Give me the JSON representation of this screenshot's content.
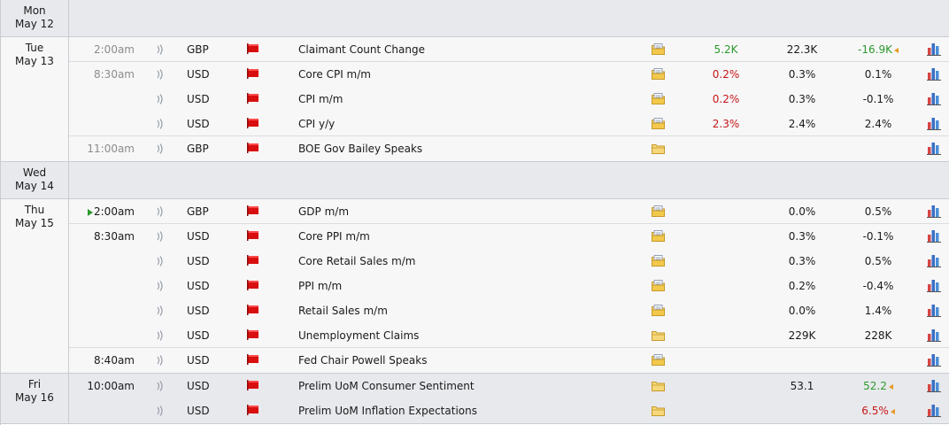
{
  "calendar": {
    "days": [
      {
        "day": "Mon",
        "date": "May 12",
        "events": []
      },
      {
        "day": "Tue",
        "date": "May 13",
        "events": [
          {
            "time": "2:00am",
            "time_bold": false,
            "upnext": false,
            "currency": "GBP",
            "title": "Claimant Count Change",
            "folder": "detail",
            "actual": "5.2K",
            "actual_color": "green",
            "forecast": "22.3K",
            "previous": "-16.9K",
            "previous_color": "green",
            "previous_revised": true,
            "sep": true
          },
          {
            "time": "8:30am",
            "time_bold": false,
            "upnext": false,
            "currency": "USD",
            "title": "Core CPI m/m",
            "folder": "detail",
            "actual": "0.2%",
            "actual_color": "red",
            "forecast": "0.3%",
            "previous": "0.1%",
            "previous_color": "",
            "previous_revised": false,
            "sep": false
          },
          {
            "time": "",
            "time_bold": false,
            "upnext": false,
            "currency": "USD",
            "title": "CPI m/m",
            "folder": "detail",
            "actual": "0.2%",
            "actual_color": "red",
            "forecast": "0.3%",
            "previous": "-0.1%",
            "previous_color": "",
            "previous_revised": false,
            "sep": false
          },
          {
            "time": "",
            "time_bold": false,
            "upnext": false,
            "currency": "USD",
            "title": "CPI y/y",
            "folder": "detail",
            "actual": "2.3%",
            "actual_color": "red",
            "forecast": "2.4%",
            "previous": "2.4%",
            "previous_color": "",
            "previous_revised": false,
            "sep": true
          },
          {
            "time": "11:00am",
            "time_bold": false,
            "upnext": false,
            "currency": "GBP",
            "title": "BOE Gov Bailey Speaks",
            "folder": "plain",
            "actual": "",
            "actual_color": "",
            "forecast": "",
            "previous": "",
            "previous_color": "",
            "previous_revised": false,
            "sep": false
          }
        ]
      },
      {
        "day": "Wed",
        "date": "May 14",
        "events": []
      },
      {
        "day": "Thu",
        "date": "May 15",
        "events": [
          {
            "time": "2:00am",
            "time_bold": true,
            "upnext": true,
            "currency": "GBP",
            "title": "GDP m/m",
            "folder": "detail",
            "actual": "",
            "actual_color": "",
            "forecast": "0.0%",
            "previous": "0.5%",
            "previous_color": "",
            "previous_revised": false,
            "sep": true
          },
          {
            "time": "8:30am",
            "time_bold": true,
            "upnext": false,
            "currency": "USD",
            "title": "Core PPI m/m",
            "folder": "detail",
            "actual": "",
            "actual_color": "",
            "forecast": "0.3%",
            "previous": "-0.1%",
            "previous_color": "",
            "previous_revised": false,
            "sep": false
          },
          {
            "time": "",
            "time_bold": true,
            "upnext": false,
            "currency": "USD",
            "title": "Core Retail Sales m/m",
            "folder": "detail",
            "actual": "",
            "actual_color": "",
            "forecast": "0.3%",
            "previous": "0.5%",
            "previous_color": "",
            "previous_revised": false,
            "sep": false
          },
          {
            "time": "",
            "time_bold": true,
            "upnext": false,
            "currency": "USD",
            "title": "PPI m/m",
            "folder": "detail",
            "actual": "",
            "actual_color": "",
            "forecast": "0.2%",
            "previous": "-0.4%",
            "previous_color": "",
            "previous_revised": false,
            "sep": false
          },
          {
            "time": "",
            "time_bold": true,
            "upnext": false,
            "currency": "USD",
            "title": "Retail Sales m/m",
            "folder": "detail",
            "actual": "",
            "actual_color": "",
            "forecast": "0.0%",
            "previous": "1.4%",
            "previous_color": "",
            "previous_revised": false,
            "sep": false
          },
          {
            "time": "",
            "time_bold": true,
            "upnext": false,
            "currency": "USD",
            "title": "Unemployment Claims",
            "folder": "plain",
            "actual": "",
            "actual_color": "",
            "forecast": "229K",
            "previous": "228K",
            "previous_color": "",
            "previous_revised": false,
            "sep": true
          },
          {
            "time": "8:40am",
            "time_bold": true,
            "upnext": false,
            "currency": "USD",
            "title": "Fed Chair Powell Speaks",
            "folder": "detail",
            "actual": "",
            "actual_color": "",
            "forecast": "",
            "previous": "",
            "previous_color": "",
            "previous_revised": false,
            "sep": false
          }
        ]
      },
      {
        "day": "Fri",
        "date": "May 16",
        "events": [
          {
            "time": "10:00am",
            "time_bold": true,
            "upnext": false,
            "currency": "USD",
            "title": "Prelim UoM Consumer Sentiment",
            "folder": "plain",
            "actual": "",
            "actual_color": "",
            "forecast": "53.1",
            "previous": "52.2",
            "previous_color": "green",
            "previous_revised": true,
            "sep": false
          },
          {
            "time": "",
            "time_bold": true,
            "upnext": false,
            "currency": "USD",
            "title": "Prelim UoM Inflation Expectations",
            "folder": "plain",
            "actual": "",
            "actual_color": "",
            "forecast": "",
            "previous": "6.5%",
            "previous_color": "red",
            "previous_revised": true,
            "sep": false
          }
        ]
      }
    ],
    "icons": {
      "speaker": "sound-icon",
      "flag": "impact-flag-icon",
      "impact_color": "#d90f0f",
      "folder": "folder-icon",
      "chart": "chart-icon"
    },
    "colors": {
      "green": "#2d9a2d",
      "red": "#c41616",
      "revision": "#e59a24"
    }
  }
}
